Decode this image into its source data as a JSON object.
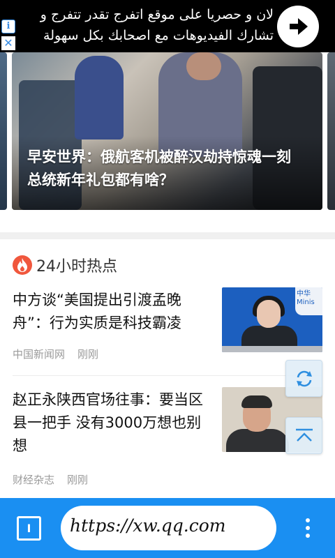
{
  "ad": {
    "line1": "لان و حصريا على موقع اتفرج تقدر تتفرج و",
    "line2": "تشارك الفيديوهات مع اصحابك بكل سهولة",
    "icons": [
      "info-icon",
      "close-icon",
      "arrow-right-icon"
    ]
  },
  "carousel": {
    "slide_title": "早安世界：俄航客机被醉汉劫持惊魂一刻 总统新年礼包都有啥？",
    "dot_count": 4,
    "active_index": 2
  },
  "hot": {
    "title": "24小时热点",
    "icon": "fire-icon"
  },
  "news": [
    {
      "title": "中方谈“美国提出引渡孟晚舟”：行为实质是科技霸凌",
      "source": "中国新闻网",
      "time": "刚刚"
    },
    {
      "title": "赵正永陕西官场往事：要当区县一把手 没有3000万想也别想",
      "source": "财经杂志",
      "time": "刚刚"
    }
  ],
  "thumb_caption": "中华\nMinis",
  "floating": {
    "refresh_icon": "refresh-icon",
    "top_icon": "back-to-top-icon"
  },
  "browser": {
    "tabs_label": "I",
    "url": "https://xw.qq.com",
    "menu_icon": "more-vertical-icon"
  },
  "colors": {
    "bar": "#1a8ff2",
    "hot_icon": "#f0573d"
  }
}
